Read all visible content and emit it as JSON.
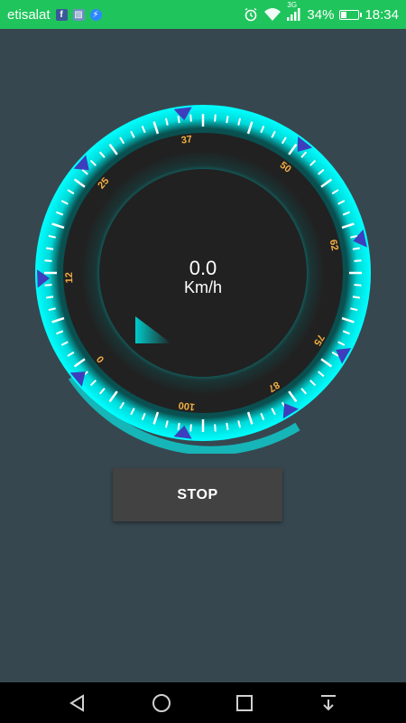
{
  "status_bar": {
    "carrier": "etisalat",
    "network_label": "3G",
    "battery_percent": "34%",
    "battery_level": 0.34,
    "time": "18:34",
    "icons": [
      "facebook-icon",
      "gallery-icon",
      "messenger-icon",
      "alarm-icon",
      "wifi-icon",
      "signal-icon",
      "battery-icon"
    ]
  },
  "gauge": {
    "ticks": [
      "37",
      "50",
      "62",
      "75",
      "87",
      "100",
      "0",
      "12",
      "25"
    ],
    "colors": {
      "ring": "#00e5e5",
      "dial": "#212121",
      "tick_label": "#f5b041",
      "marker": "#3d3dbd"
    }
  },
  "speed": {
    "value": "0.0",
    "unit": "Km/h",
    "value_numeric": 0.0
  },
  "buttons": {
    "stop_label": "STOP"
  },
  "nav_bar": {
    "items": [
      "back-icon",
      "home-icon",
      "recents-icon",
      "notification-pull-icon"
    ]
  }
}
